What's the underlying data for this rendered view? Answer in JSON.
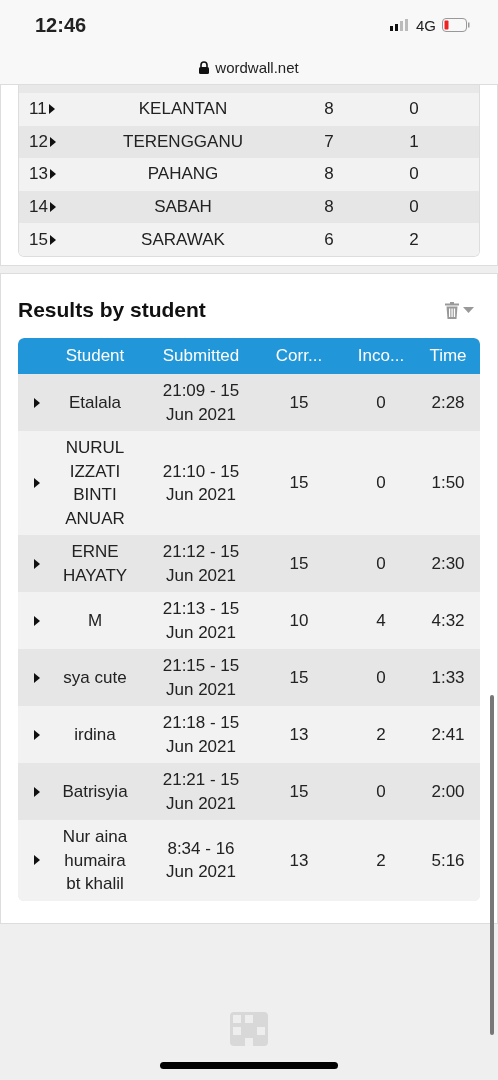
{
  "status_bar": {
    "time": "12:46",
    "network": "4G"
  },
  "address_bar": {
    "url": "wordwall.net"
  },
  "leaderboard": {
    "rows": [
      {
        "rank": "11",
        "name": "KELANTAN",
        "correct": "8",
        "incorrect": "0"
      },
      {
        "rank": "12",
        "name": "TERENGGANU",
        "correct": "7",
        "incorrect": "1"
      },
      {
        "rank": "13",
        "name": "PAHANG",
        "correct": "8",
        "incorrect": "0"
      },
      {
        "rank": "14",
        "name": "SABAH",
        "correct": "8",
        "incorrect": "0"
      },
      {
        "rank": "15",
        "name": "SARAWAK",
        "correct": "6",
        "incorrect": "2"
      }
    ]
  },
  "results_by_student": {
    "title": "Results by student",
    "columns": [
      "Student",
      "Submitted",
      "Corr...",
      "Inco...",
      "Time"
    ],
    "rows": [
      {
        "student": "Etalala",
        "submitted": "21:09 - 15 Jun 2021",
        "correct": "15",
        "incorrect": "0",
        "time": "2:28"
      },
      {
        "student": "NURUL IZZATI BINTI ANUAR",
        "submitted": "21:10 - 15 Jun 2021",
        "correct": "15",
        "incorrect": "0",
        "time": "1:50"
      },
      {
        "student": "ERNE HAYATY",
        "submitted": "21:12 - 15 Jun 2021",
        "correct": "15",
        "incorrect": "0",
        "time": "2:30"
      },
      {
        "student": "M",
        "submitted": "21:13 - 15 Jun 2021",
        "correct": "10",
        "incorrect": "4",
        "time": "4:32"
      },
      {
        "student": "sya cute",
        "submitted": "21:15 - 15 Jun 2021",
        "correct": "15",
        "incorrect": "0",
        "time": "1:33"
      },
      {
        "student": "irdina",
        "submitted": "21:18 - 15 Jun 2021",
        "correct": "13",
        "incorrect": "2",
        "time": "2:41"
      },
      {
        "student": "Batrisyia",
        "submitted": "21:21 - 15 Jun 2021",
        "correct": "15",
        "incorrect": "0",
        "time": "2:00"
      },
      {
        "student": "Nur aina humaira bt khalil",
        "submitted": "8:34 - 16 Jun 2021",
        "correct": "13",
        "incorrect": "2",
        "time": "5:16"
      }
    ]
  }
}
